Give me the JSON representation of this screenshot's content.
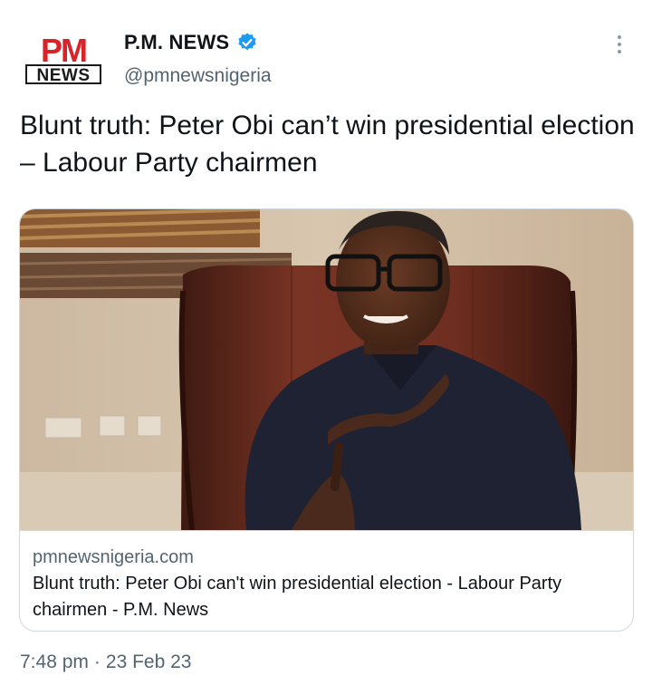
{
  "header": {
    "avatar_logo_top": "PM",
    "avatar_logo_bottom": "NEWS",
    "display_name": "P.M. NEWS",
    "handle": "@pmnewsnigeria",
    "verified": true,
    "more_icon": "more-vertical-icon"
  },
  "tweet": {
    "text": "Blunt truth: Peter Obi can’t win presidential election – Labour Party chairmen"
  },
  "card": {
    "domain": "pmnewsnigeria.com",
    "title": "Blunt truth: Peter Obi can't win presidential election - Labour Party chairmen - P.M. News"
  },
  "meta": {
    "time": "7:48 pm",
    "separator": "·",
    "date": "23 Feb 23"
  },
  "colors": {
    "brand_red": "#d7242a",
    "verified_blue": "#1d9bf0",
    "secondary_text": "#536471",
    "border": "#cfd9de"
  }
}
